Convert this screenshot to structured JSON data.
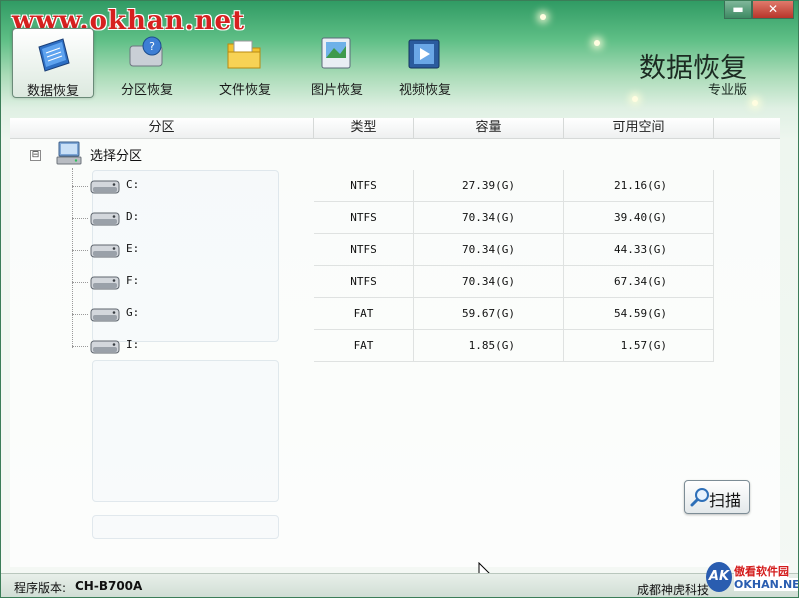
{
  "watermark": "www.okhan.net",
  "window": {
    "minimize_glyph": "▬",
    "close_glyph": "✕"
  },
  "toolbar": {
    "items": [
      {
        "label": "数据恢复",
        "icon": "data-recovery-icon",
        "active": true
      },
      {
        "label": "分区恢复",
        "icon": "partition-recovery-icon",
        "active": false
      },
      {
        "label": "文件恢复",
        "icon": "file-recovery-icon",
        "active": false
      },
      {
        "label": "图片恢复",
        "icon": "image-recovery-icon",
        "active": false
      },
      {
        "label": "视频恢复",
        "icon": "video-recovery-icon",
        "active": false
      }
    ]
  },
  "brand": {
    "title": "数据恢复",
    "edition": "专业版"
  },
  "table": {
    "columns": [
      "分区",
      "类型",
      "容量",
      "可用空间"
    ],
    "root": {
      "expander": "⊟",
      "label": "选择分区"
    },
    "rows": [
      {
        "drive": "C:",
        "type": "NTFS",
        "capacity": "27.39(G)",
        "free": "21.16(G)"
      },
      {
        "drive": "D:",
        "type": "NTFS",
        "capacity": "70.34(G)",
        "free": "39.40(G)"
      },
      {
        "drive": "E:",
        "type": "NTFS",
        "capacity": "70.34(G)",
        "free": "44.33(G)"
      },
      {
        "drive": "F:",
        "type": "NTFS",
        "capacity": "70.34(G)",
        "free": "67.34(G)"
      },
      {
        "drive": "G:",
        "type": "FAT",
        "capacity": "59.67(G)",
        "free": "54.59(G)"
      },
      {
        "drive": "I:",
        "type": "FAT",
        "capacity": "1.85(G)",
        "free": "1.57(G)"
      }
    ]
  },
  "scan_button": {
    "label": "扫描"
  },
  "status": {
    "version_label": "程序版本:",
    "version_value": "CH-B700A",
    "company": "成都神虎科技"
  },
  "logo": {
    "top": "傲看软件园",
    "bottom": "OKHAN.NET",
    "mark": "AK"
  },
  "colors": {
    "header_green": "#2f9a63",
    "brand_red": "#d41b1b",
    "logo_blue": "#2a5db0"
  }
}
